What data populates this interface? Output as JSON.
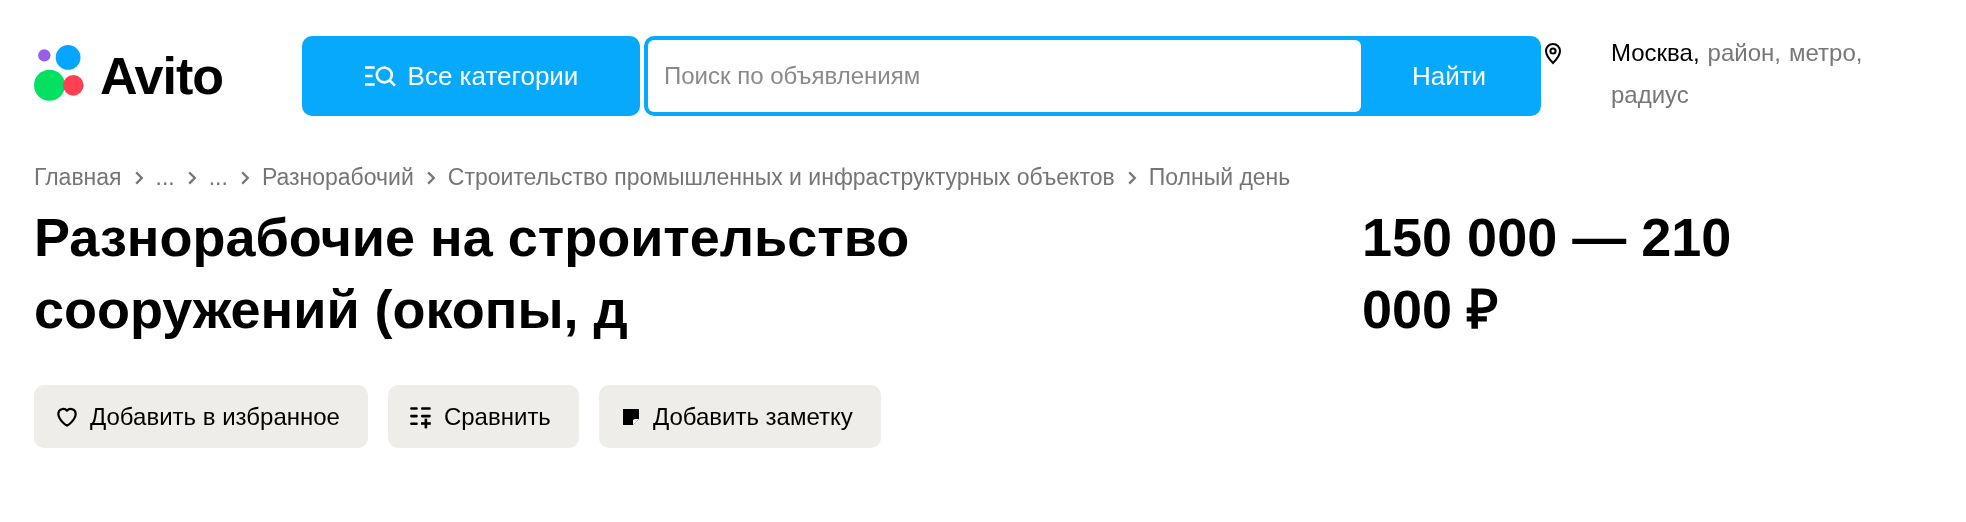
{
  "header": {
    "logo": "Avito",
    "categories_button": "Все категории",
    "search": {
      "placeholder": "Поиск по объявлениям",
      "button": "Найти"
    },
    "location": [
      {
        "text": "Москва,",
        "active": true
      },
      {
        "text": "район,",
        "active": false
      },
      {
        "text": "метро,",
        "active": false
      },
      {
        "text": "радиус",
        "active": false
      }
    ]
  },
  "breadcrumbs": [
    "Главная",
    "...",
    "...",
    "Разнорабочий",
    "Строительство промышленных и инфраструктурных объектов",
    "Полный день"
  ],
  "title": "Разнорабочие на строительство сооружений (окопы, д",
  "price": "150 000 — 210 000 ₽",
  "actions": [
    {
      "kind": "favorite",
      "label": "Добавить в избранное"
    },
    {
      "kind": "compare",
      "label": "Сравнить"
    },
    {
      "kind": "note",
      "label": "Добавить заметку"
    }
  ]
}
